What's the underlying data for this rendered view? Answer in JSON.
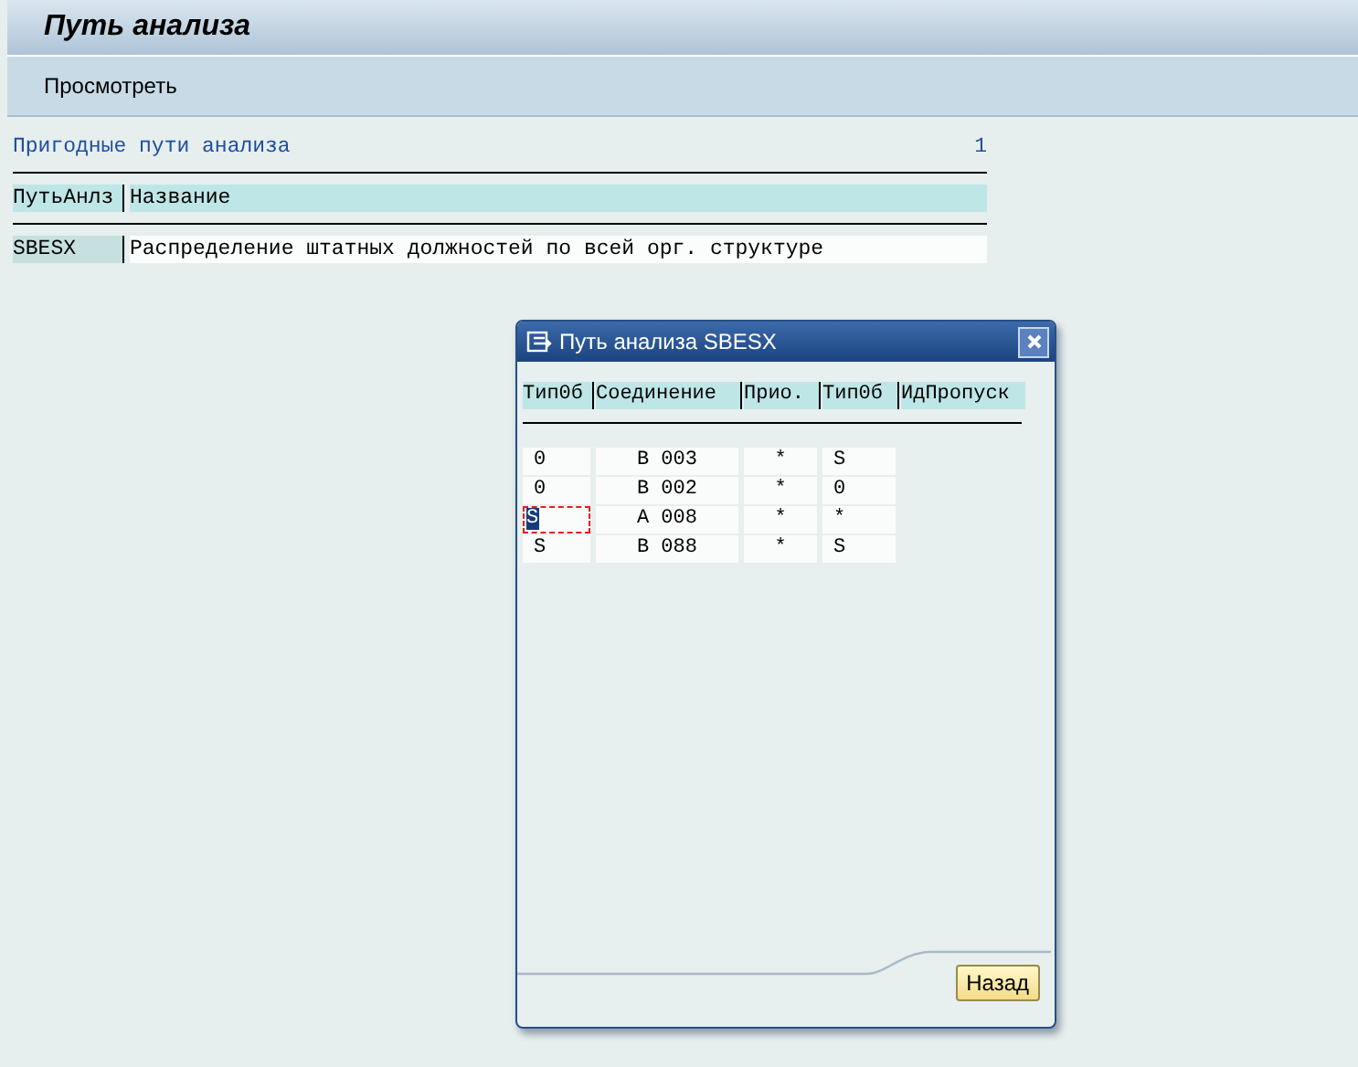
{
  "window": {
    "title": "Путь анализа"
  },
  "toolbar": {
    "buttons": [
      "Просмотреть"
    ]
  },
  "list": {
    "title": "Пригодные пути анализа",
    "count": "1",
    "columns": [
      "ПутьАнлз",
      "Название"
    ],
    "rows": [
      [
        "SBESX",
        "Распределение штатных должностей по всей орг. структуре"
      ]
    ]
  },
  "dialog": {
    "title": "Путь анализа SBESX",
    "columns": [
      "Тип0б",
      "Соединение",
      "Прио.",
      "Тип0б",
      "ИдПропуск"
    ],
    "rows": [
      {
        "cells": [
          "0",
          "B 003",
          "*",
          "S"
        ],
        "focused": false
      },
      {
        "cells": [
          "0",
          "B 002",
          "*",
          "0"
        ],
        "focused": false
      },
      {
        "cells": [
          "S",
          "A 008",
          "*",
          "*"
        ],
        "focused": true
      },
      {
        "cells": [
          "S",
          "B 088",
          "*",
          "S"
        ],
        "focused": false
      }
    ],
    "buttons": [
      "Назад"
    ]
  }
}
